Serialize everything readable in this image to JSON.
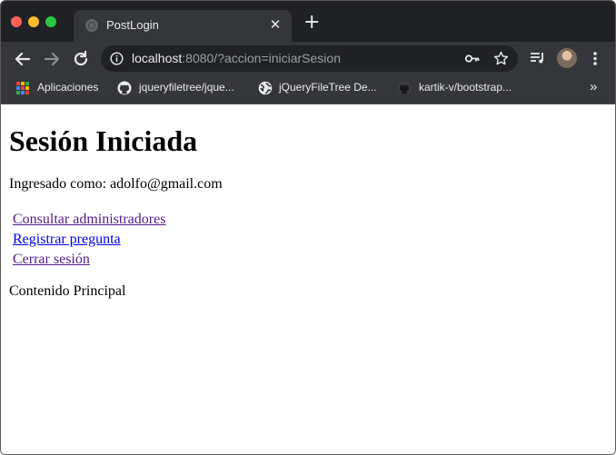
{
  "browser": {
    "tab": {
      "title": "PostLogin",
      "close_glyph": "✕"
    },
    "new_tab_glyph": "+",
    "url": {
      "host": "localhost",
      "rest": ":8080/?accion=iniciarSesion"
    },
    "bookmarks": [
      {
        "label": "Aplicaciones",
        "icon": "apps-grid-icon"
      },
      {
        "label": "jqueryfiletree/jque...",
        "icon": "github-icon"
      },
      {
        "label": "jQueryFileTree De...",
        "icon": "globe-icon"
      },
      {
        "label": "kartik-v/bootstrap...",
        "icon": "github-icon"
      }
    ],
    "bookmarks_overflow": "»"
  },
  "page": {
    "heading": "Sesión Iniciada",
    "logged_in_text": "Ingresado como: adolfo@gmail.com",
    "links": [
      {
        "label": "Consultar administradores",
        "visited": true
      },
      {
        "label": "Registrar pregunta",
        "visited": false
      },
      {
        "label": "Cerrar sesión",
        "visited": true
      }
    ],
    "main_content": "Contenido Principal"
  },
  "colors": {
    "tabstrip_bg": "#202124",
    "toolbar_bg": "#35363a",
    "link_visited": "#551a8b",
    "link_unvisited": "#0000ee"
  }
}
